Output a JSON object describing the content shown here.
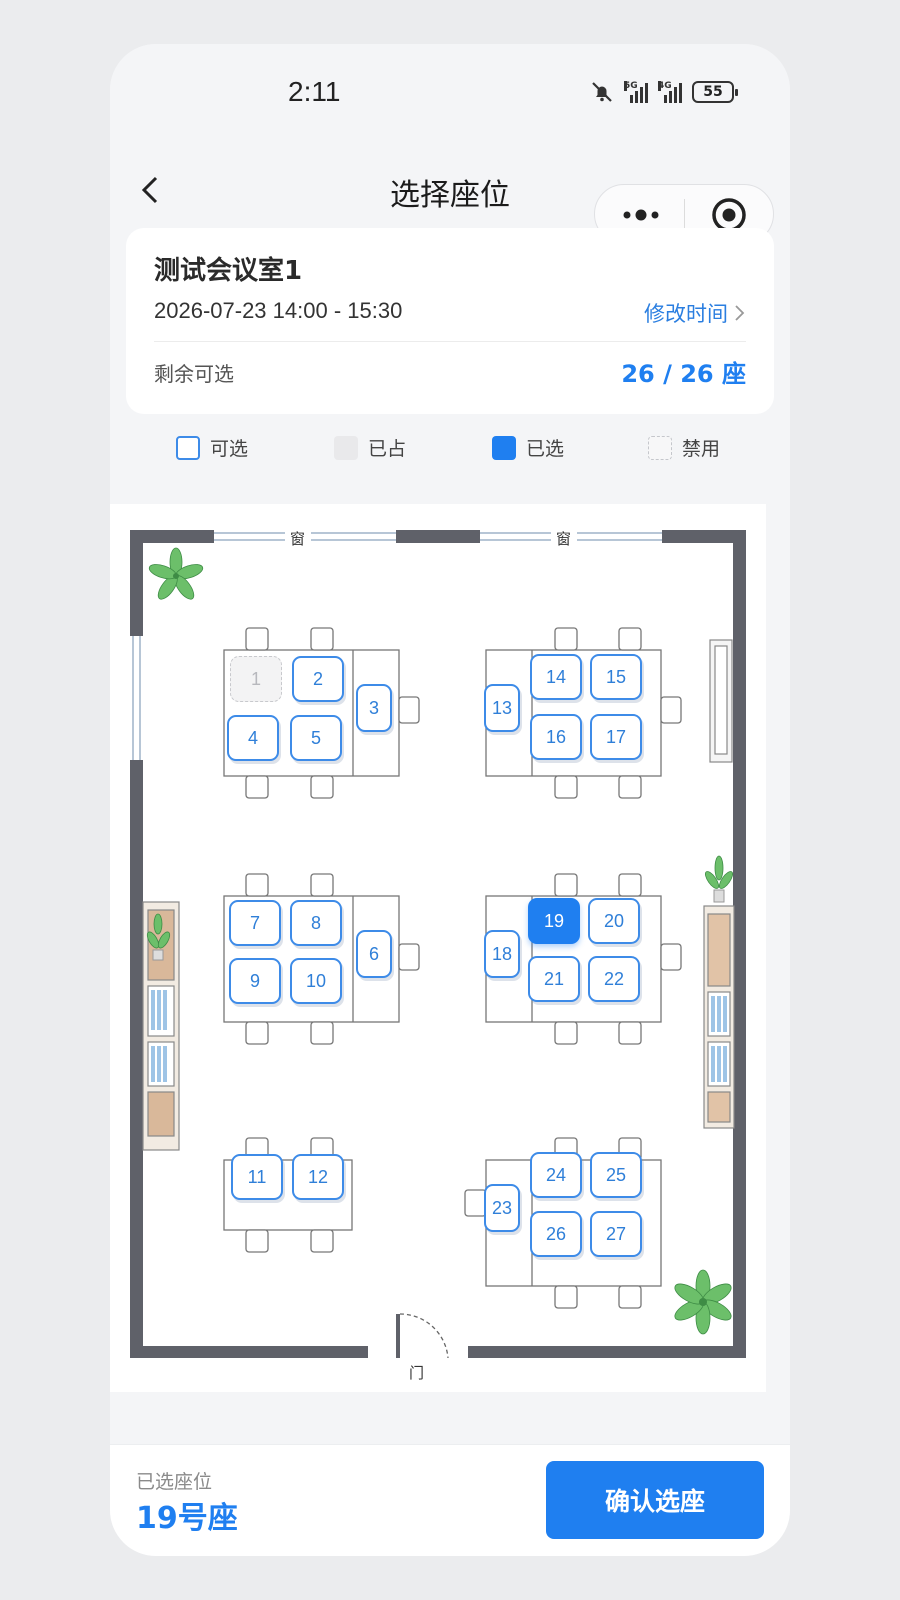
{
  "status_bar": {
    "time": "2:11",
    "network_1": "5G",
    "network_2": "4G",
    "battery": "55"
  },
  "nav": {
    "title": "选择座位",
    "back_icon": "chevron-left-icon",
    "more_icon": "more-dots-icon",
    "close_icon": "target-icon"
  },
  "info": {
    "room": "测试会议室1",
    "datetime": "2026-07-23  14:00 - 15:30",
    "modify_label": "修改时间",
    "remaining_label": "剩余可选",
    "remaining_value": "26 / 26 座"
  },
  "legend": {
    "available": "可选",
    "taken": "已占",
    "selected": "已选",
    "disabled": "禁用"
  },
  "floor": {
    "window_label_1": "窗",
    "window_label_2": "窗",
    "door_label": "门"
  },
  "seats": [
    {
      "n": "1",
      "state": "taken"
    },
    {
      "n": "2",
      "state": "available"
    },
    {
      "n": "3",
      "state": "available"
    },
    {
      "n": "4",
      "state": "available"
    },
    {
      "n": "5",
      "state": "available"
    },
    {
      "n": "6",
      "state": "available"
    },
    {
      "n": "7",
      "state": "available"
    },
    {
      "n": "8",
      "state": "available"
    },
    {
      "n": "9",
      "state": "available"
    },
    {
      "n": "10",
      "state": "available"
    },
    {
      "n": "11",
      "state": "available"
    },
    {
      "n": "12",
      "state": "available"
    },
    {
      "n": "13",
      "state": "available"
    },
    {
      "n": "14",
      "state": "available"
    },
    {
      "n": "15",
      "state": "available"
    },
    {
      "n": "16",
      "state": "available"
    },
    {
      "n": "17",
      "state": "available"
    },
    {
      "n": "18",
      "state": "available"
    },
    {
      "n": "19",
      "state": "selected"
    },
    {
      "n": "20",
      "state": "available"
    },
    {
      "n": "21",
      "state": "available"
    },
    {
      "n": "22",
      "state": "available"
    },
    {
      "n": "23",
      "state": "available"
    },
    {
      "n": "24",
      "state": "available"
    },
    {
      "n": "25",
      "state": "available"
    },
    {
      "n": "26",
      "state": "available"
    },
    {
      "n": "27",
      "state": "available"
    }
  ],
  "bottom": {
    "selected_label": "已选座位",
    "selected_value": "19号座",
    "confirm_label": "确认选座"
  },
  "colors": {
    "accent": "#1f7ff0",
    "seat_border": "#3d8be8",
    "wall": "#5f6169"
  }
}
